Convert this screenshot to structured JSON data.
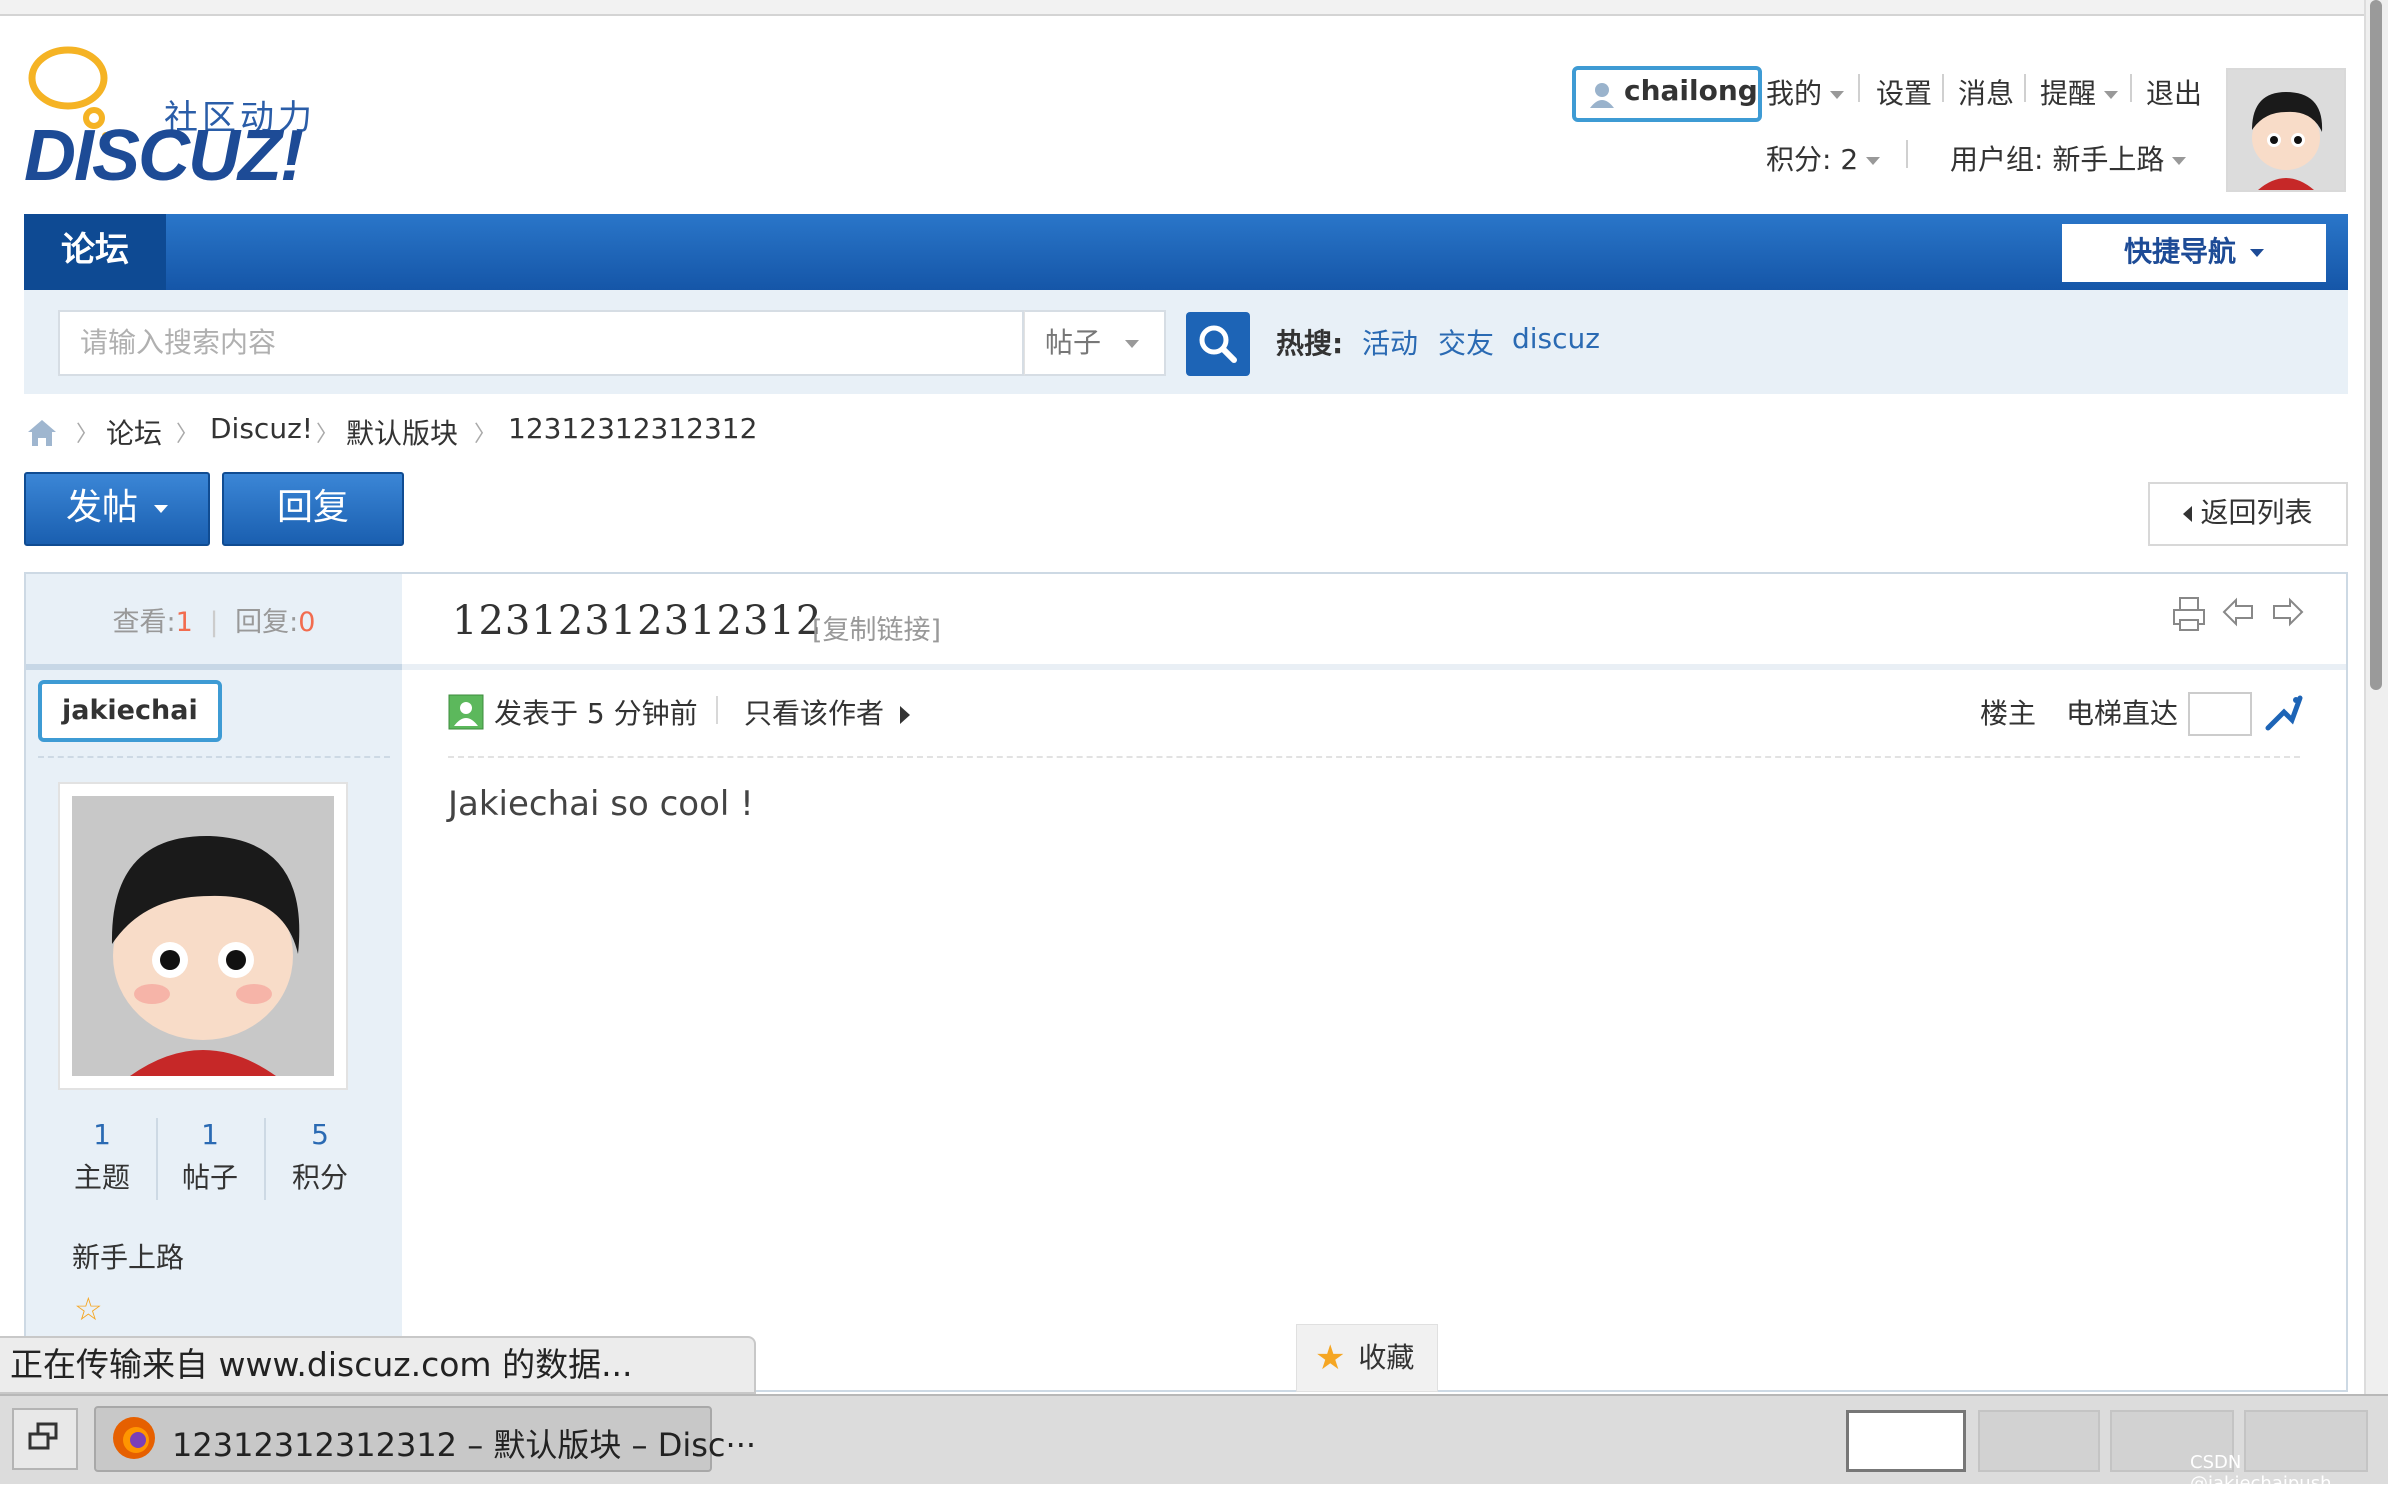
{
  "logo": {
    "sub": "社区动力",
    "text": "DISCUZ!"
  },
  "user": {
    "name": "chailong",
    "menu": [
      "我的",
      "设置",
      "消息",
      "提醒",
      "退出"
    ],
    "points": "积分: 2",
    "group": "用户组: 新手上路"
  },
  "nav": {
    "forum": "论坛",
    "quick_nav": "快捷导航"
  },
  "search": {
    "placeholder": "请输入搜索内容",
    "type": "帖子",
    "hot_label": "热搜:",
    "hot": [
      "活动",
      "交友",
      "discuz"
    ]
  },
  "breadcrumb": [
    "论坛",
    "Discuz!",
    "默认版块",
    "12312312312312"
  ],
  "buttons": {
    "post": "发帖",
    "reply": "回复",
    "back": "返回列表"
  },
  "thread": {
    "views_label": "查看:",
    "views": "1",
    "replies_label": "回复:",
    "replies": "0",
    "title": "12312312312312",
    "copy_link": "[复制链接]"
  },
  "author": {
    "name": "jakiechai",
    "stats": [
      {
        "num": "1",
        "label": "主题"
      },
      {
        "num": "1",
        "label": "帖子"
      },
      {
        "num": "5",
        "label": "积分"
      }
    ],
    "group": "新手上路"
  },
  "post": {
    "posted": "发表于 5 分钟前",
    "only_author": "只看该作者",
    "floor": "楼主",
    "elevator": "电梯直达",
    "body": "Jakiechai so cool !"
  },
  "status_text": "正在传输来自 www.discuz.com 的数据...",
  "favorite": "收藏",
  "taskbar": {
    "window_title": "12312312312312 – 默认版块 – Disc···"
  },
  "watermark": "CSDN @jakiechaipush",
  "colors": {
    "brand_blue": "#1d64b6",
    "link_blue": "#2a6ab3",
    "highlight": "#3e9bd4",
    "stat_red": "#f26c4f"
  }
}
